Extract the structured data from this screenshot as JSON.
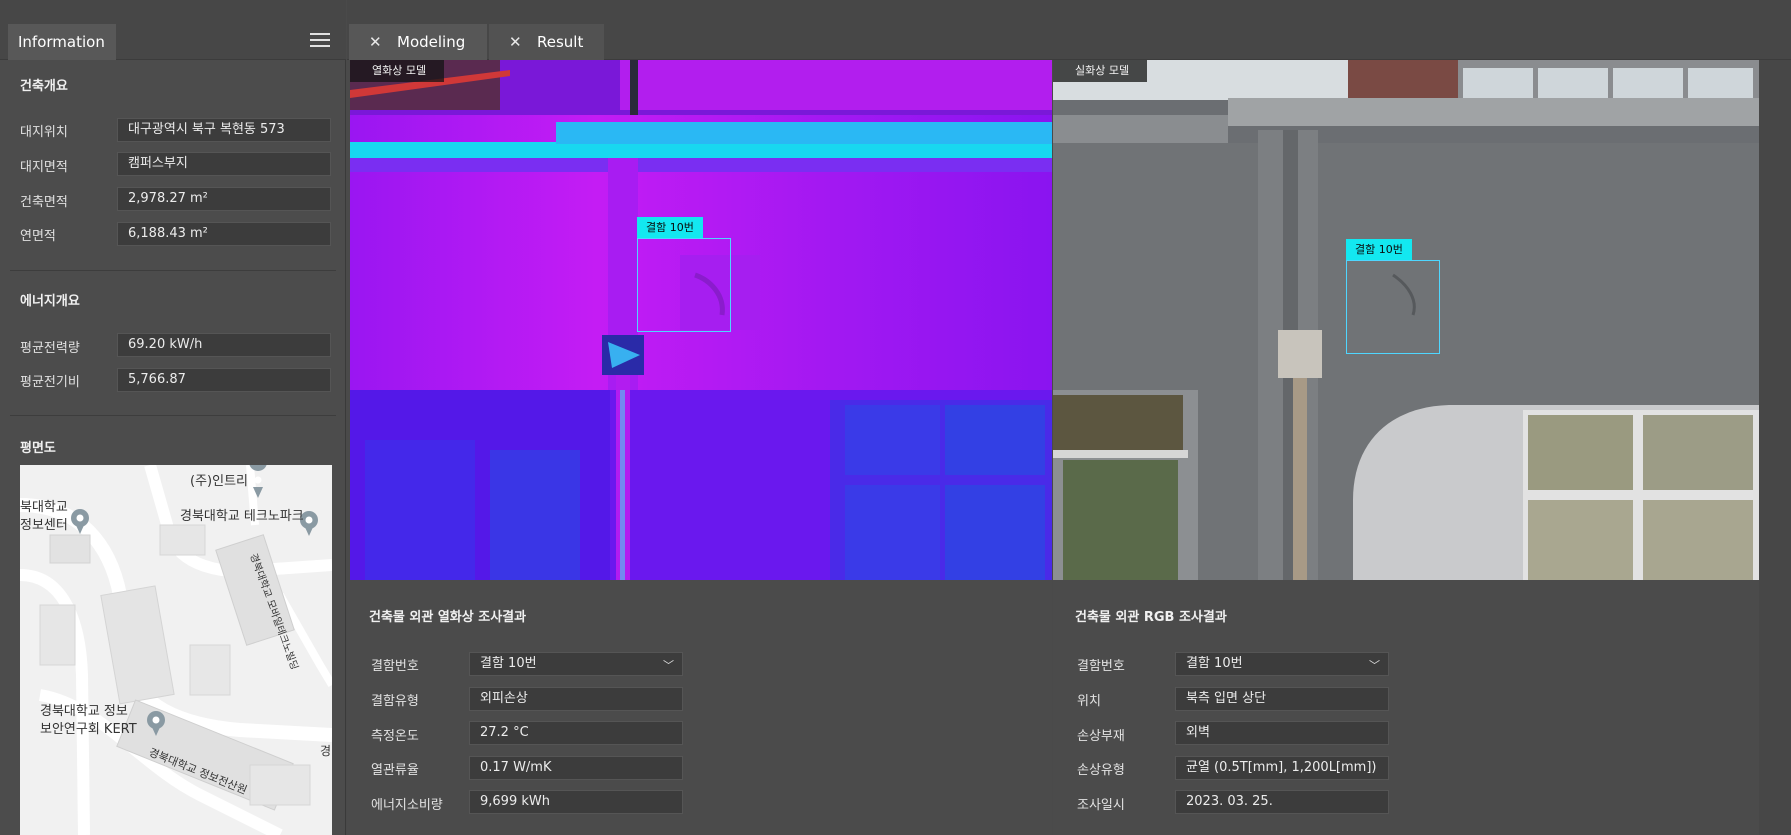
{
  "sidebar": {
    "tab_label": "Information",
    "menu_icon": "hamburger-menu-icon",
    "building": {
      "title": "건축개요",
      "rows": [
        {
          "label": "대지위치",
          "value": "대구광역시 북구 복현동 573"
        },
        {
          "label": "대지면적",
          "value": "캠퍼스부지"
        },
        {
          "label": "건축면적",
          "value": "2,978.27 m²"
        },
        {
          "label": "연면적",
          "value": "6,188.43 m²"
        }
      ]
    },
    "energy": {
      "title": "에너지개요",
      "rows": [
        {
          "label": "평균전력량",
          "value": "69.20 kW/h"
        },
        {
          "label": "평균전기비",
          "value": "5,766.87"
        }
      ]
    },
    "floorplan": {
      "title": "평면도",
      "map_labels": {
        "intree": "(주)인트리",
        "info_center_1": "북대학교",
        "info_center_2": "정보센터",
        "technopark": "경북대학교 테크노파크",
        "mobile_bldg": "경북대학교 모바일테크노빌딩",
        "kert_1": "경북대학교 정보",
        "kert_2": "보안연구회 KERT",
        "info_bldg": "경북대학교 정보전산원",
        "edge": "경"
      }
    }
  },
  "tabs": [
    {
      "label": "Modeling",
      "close_icon": "close-icon",
      "active": true
    },
    {
      "label": "Result",
      "close_icon": "close-icon",
      "active": false
    }
  ],
  "viewers": {
    "thermal": {
      "label": "열화상 모델",
      "defect_tag": "결함 10번"
    },
    "rgb": {
      "label": "실화상 모델",
      "defect_tag": "결함 10번"
    }
  },
  "thermal_panel": {
    "title": "건축물 외관 열화상 조사결과",
    "rows": [
      {
        "label": "결함번호",
        "value": "결함 10번",
        "select": true
      },
      {
        "label": "결함유형",
        "value": "외피손상"
      },
      {
        "label": "측정온도",
        "value": "27.2 °C"
      },
      {
        "label": "열관류율",
        "value": "0.17 W/mK"
      },
      {
        "label": "에너지소비량",
        "value": "9,699 kWh"
      }
    ]
  },
  "rgb_panel": {
    "title": "건축물 외관 RGB 조사결과",
    "rows": [
      {
        "label": "결함번호",
        "value": "결함 10번",
        "select": true
      },
      {
        "label": "위치",
        "value": "북측 입면 상단"
      },
      {
        "label": "손상부재",
        "value": "외벽"
      },
      {
        "label": "손상유형",
        "value": "균열 (0.5T[mm], 1,200L[mm])"
      },
      {
        "label": "조사일시",
        "value": "2023. 03. 25."
      }
    ]
  },
  "colors": {
    "defect_tag": "#13e8f0",
    "defect_box": "#4fd6ff",
    "sidebar_bg": "#4c4c4c",
    "field_bg": "#3c3c3c"
  }
}
